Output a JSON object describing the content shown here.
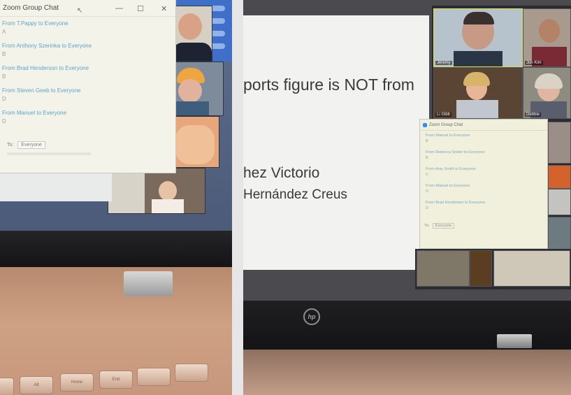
{
  "left_photo": {
    "chat_window": {
      "title": "Zoom Group Chat",
      "window_buttons": [
        "—",
        "☐",
        "✕"
      ],
      "messages": [
        {
          "from": "From T.Pappy to Everyone",
          "body": "A"
        },
        {
          "from": "From Anthony Szerinka to Everyone",
          "body": "B"
        },
        {
          "from": "From Brad Henderson to Everyone",
          "body": "B"
        },
        {
          "from": "From Steven Geeb to Everyone",
          "body": "D"
        },
        {
          "from": "From Manuel to Everyone",
          "body": "D"
        }
      ],
      "to_label": "To:",
      "to_value": "Everyone"
    },
    "keys": [
      "",
      "Alt",
      "Home",
      "End",
      "",
      ""
    ]
  },
  "right_photo": {
    "slide": {
      "line1": "ports figure is NOT from",
      "line2": "hez Victorio",
      "line3": "Hernández Creus"
    },
    "gallery": {
      "tiles": [
        {
          "name": "Jeremy"
        },
        {
          "name": "Jun Kim"
        },
        {
          "name": "Li Gibb"
        },
        {
          "name": "Debbie"
        }
      ]
    },
    "chat_window": {
      "title": "Zoom Group Chat",
      "messages": [
        {
          "from": "From Manuel to Everyone",
          "body": "B"
        },
        {
          "from": "From Rebecca Snider to Everyone",
          "body": "B"
        },
        {
          "from": "From Amy Smith to Everyone",
          "body": "C"
        },
        {
          "from": "From Manuel to Everyone",
          "body": "D"
        },
        {
          "from": "From Brad Henderson to Everyone",
          "body": "D"
        }
      ],
      "to_label": "To:",
      "to_value": "Everyone"
    },
    "logo": "hp"
  }
}
